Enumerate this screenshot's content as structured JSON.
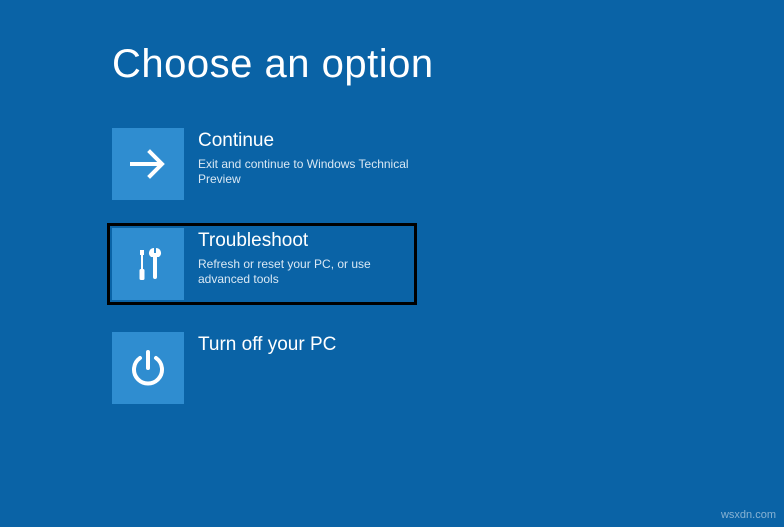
{
  "title": "Choose an option",
  "options": [
    {
      "icon": "arrow-right-icon",
      "title": "Continue",
      "description": "Exit and continue to Windows Technical Preview"
    },
    {
      "icon": "tools-icon",
      "title": "Troubleshoot",
      "description": "Refresh or reset your PC, or use advanced tools"
    },
    {
      "icon": "power-icon",
      "title": "Turn off your PC",
      "description": ""
    }
  ],
  "watermark": "wsxdn.com"
}
